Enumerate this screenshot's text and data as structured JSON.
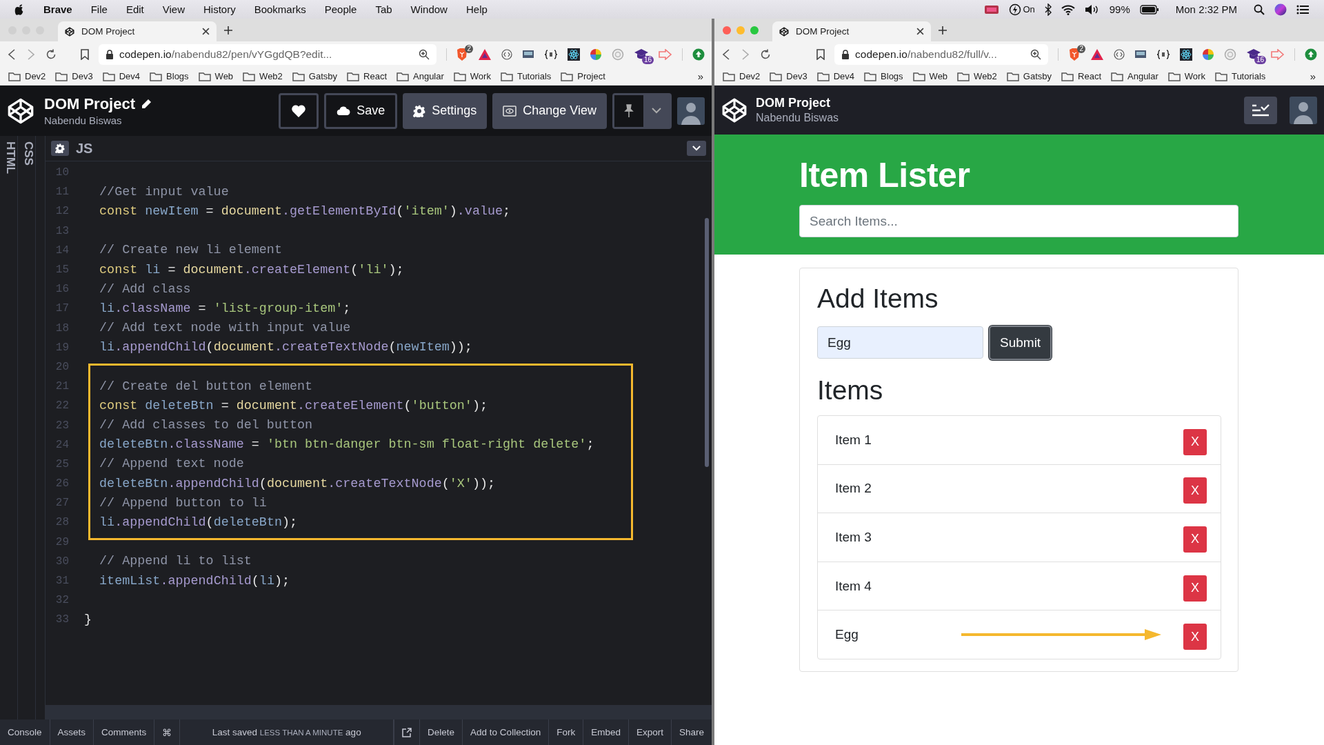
{
  "menu_bar": {
    "app": "Brave",
    "menus": [
      "File",
      "Edit",
      "View",
      "History",
      "Bookmarks",
      "People",
      "Tab",
      "Window",
      "Help"
    ],
    "focus_label": "On",
    "battery": "99%",
    "clock": "Mon 2:32 PM"
  },
  "windows": [
    {
      "active": false,
      "tab_title": "DOM Project",
      "url_host": "codepen.io",
      "url_path": "/nabendu82/pen/vYGgdQB?edit...",
      "shield_badge": "2",
      "extension_badge": "16",
      "bookmarks": [
        "Dev2",
        "Dev3",
        "Dev4",
        "Blogs",
        "Web",
        "Web2",
        "Gatsby",
        "React",
        "Angular",
        "Work",
        "Tutorials",
        "Project"
      ],
      "bookmarks_overflow": "»",
      "page": {
        "kind": "editor",
        "title": "DOM Project",
        "author": "Nabendu Biswas",
        "buttons": [
          {
            "kind": "heart"
          },
          {
            "kind": "save",
            "label": "Save"
          },
          {
            "kind": "settings",
            "label": "Settings"
          },
          {
            "kind": "change-view",
            "label": "Change View"
          }
        ],
        "side_tabs": [
          "HTML",
          "CSS"
        ],
        "panel_label": "JS",
        "code": [
          {
            "highlighted": false,
            "lines": [
              {
                "number": "10"
              },
              {
                "number": "11",
                "tokens": [
                  {
                    "kind": "comment",
                    "text": "  //Get input value"
                  }
                ]
              },
              {
                "number": "12",
                "tokens": [
                  {
                    "kind": "keyword",
                    "text": "  const"
                  },
                  {
                    "kind": "var",
                    "text": " newItem"
                  },
                  {
                    "kind": "punct",
                    "text": " = "
                  },
                  {
                    "kind": "object",
                    "text": "document"
                  },
                  {
                    "kind": "method",
                    "text": ".getElementById"
                  },
                  {
                    "kind": "punct",
                    "text": "("
                  },
                  {
                    "kind": "string",
                    "text": "'item'"
                  },
                  {
                    "kind": "punct",
                    "text": ")"
                  },
                  {
                    "kind": "method",
                    "text": ".value"
                  },
                  {
                    "kind": "punct",
                    "text": ";"
                  }
                ]
              },
              {
                "number": "13"
              },
              {
                "number": "14",
                "tokens": [
                  {
                    "kind": "comment",
                    "text": "  // Create new li element"
                  }
                ]
              },
              {
                "number": "15",
                "tokens": [
                  {
                    "kind": "keyword",
                    "text": "  const"
                  },
                  {
                    "kind": "var",
                    "text": " li"
                  },
                  {
                    "kind": "punct",
                    "text": " = "
                  },
                  {
                    "kind": "object",
                    "text": "document"
                  },
                  {
                    "kind": "method",
                    "text": ".createElement"
                  },
                  {
                    "kind": "punct",
                    "text": "("
                  },
                  {
                    "kind": "string",
                    "text": "'li'"
                  },
                  {
                    "kind": "punct",
                    "text": ");"
                  }
                ]
              },
              {
                "number": "16",
                "tokens": [
                  {
                    "kind": "comment",
                    "text": "  // Add class"
                  }
                ]
              },
              {
                "number": "17",
                "tokens": [
                  {
                    "kind": "var",
                    "text": "  li"
                  },
                  {
                    "kind": "method",
                    "text": ".className"
                  },
                  {
                    "kind": "punct",
                    "text": " = "
                  },
                  {
                    "kind": "string",
                    "text": "'list-group-item'"
                  },
                  {
                    "kind": "punct",
                    "text": ";"
                  }
                ]
              },
              {
                "number": "18",
                "tokens": [
                  {
                    "kind": "comment",
                    "text": "  // Add text node with input value"
                  }
                ]
              },
              {
                "number": "19",
                "tokens": [
                  {
                    "kind": "var",
                    "text": "  li"
                  },
                  {
                    "kind": "method",
                    "text": ".appendChild"
                  },
                  {
                    "kind": "punct",
                    "text": "("
                  },
                  {
                    "kind": "object",
                    "text": "document"
                  },
                  {
                    "kind": "method",
                    "text": ".createTextNode"
                  },
                  {
                    "kind": "punct",
                    "text": "("
                  },
                  {
                    "kind": "var",
                    "text": "newItem"
                  },
                  {
                    "kind": "punct",
                    "text": "));"
                  }
                ]
              },
              {
                "number": "20"
              }
            ]
          },
          {
            "highlighted": true,
            "lines": [
              {
                "number": "21",
                "tokens": [
                  {
                    "kind": "comment",
                    "text": "  // Create del button element"
                  }
                ]
              },
              {
                "number": "22",
                "tokens": [
                  {
                    "kind": "keyword",
                    "text": "  const"
                  },
                  {
                    "kind": "var",
                    "text": " deleteBtn"
                  },
                  {
                    "kind": "punct",
                    "text": " = "
                  },
                  {
                    "kind": "object",
                    "text": "document"
                  },
                  {
                    "kind": "method",
                    "text": ".createElement"
                  },
                  {
                    "kind": "punct",
                    "text": "("
                  },
                  {
                    "kind": "string",
                    "text": "'button'"
                  },
                  {
                    "kind": "punct",
                    "text": ");"
                  }
                ]
              },
              {
                "number": "23",
                "tokens": [
                  {
                    "kind": "comment",
                    "text": "  // Add classes to del button"
                  }
                ]
              },
              {
                "number": "24",
                "tokens": [
                  {
                    "kind": "var",
                    "text": "  deleteBtn"
                  },
                  {
                    "kind": "method",
                    "text": ".className"
                  },
                  {
                    "kind": "punct",
                    "text": " = "
                  },
                  {
                    "kind": "string",
                    "text": "'btn btn-danger btn-sm float-right delete'"
                  },
                  {
                    "kind": "punct",
                    "text": ";"
                  }
                ]
              },
              {
                "number": "25",
                "tokens": [
                  {
                    "kind": "comment",
                    "text": "  // Append text node"
                  }
                ]
              },
              {
                "number": "26",
                "tokens": [
                  {
                    "kind": "var",
                    "text": "  deleteBtn"
                  },
                  {
                    "kind": "method",
                    "text": ".appendChild"
                  },
                  {
                    "kind": "punct",
                    "text": "("
                  },
                  {
                    "kind": "object",
                    "text": "document"
                  },
                  {
                    "kind": "method",
                    "text": ".createTextNode"
                  },
                  {
                    "kind": "punct",
                    "text": "("
                  },
                  {
                    "kind": "string",
                    "text": "'X'"
                  },
                  {
                    "kind": "punct",
                    "text": "));"
                  }
                ]
              },
              {
                "number": "27",
                "tokens": [
                  {
                    "kind": "comment",
                    "text": "  // Append button to li"
                  }
                ]
              },
              {
                "number": "28",
                "tokens": [
                  {
                    "kind": "var",
                    "text": "  li"
                  },
                  {
                    "kind": "method",
                    "text": ".appendChild"
                  },
                  {
                    "kind": "punct",
                    "text": "("
                  },
                  {
                    "kind": "var",
                    "text": "deleteBtn"
                  },
                  {
                    "kind": "punct",
                    "text": ");"
                  }
                ]
              }
            ]
          },
          {
            "highlighted": false,
            "lines": [
              {
                "number": "29"
              },
              {
                "number": "30",
                "tokens": [
                  {
                    "kind": "comment",
                    "text": "  // Append li to list"
                  }
                ]
              },
              {
                "number": "31",
                "tokens": [
                  {
                    "kind": "var",
                    "text": "  itemList"
                  },
                  {
                    "kind": "method",
                    "text": ".appendChild"
                  },
                  {
                    "kind": "punct",
                    "text": "("
                  },
                  {
                    "kind": "var",
                    "text": "li"
                  },
                  {
                    "kind": "punct",
                    "text": ");"
                  }
                ]
              },
              {
                "number": "32"
              },
              {
                "number": "33",
                "tokens": [
                  {
                    "kind": "punct",
                    "text": "}"
                  }
                ]
              }
            ]
          }
        ],
        "footer_left": [
          "Console",
          "Assets",
          "Comments",
          "⌘"
        ],
        "last_saved": {
          "prefix": "Last saved",
          "time": "LESS THAN A MINUTE",
          "suffix": "ago"
        },
        "footer_right": [
          "Delete",
          "Add to Collection",
          "Fork",
          "Embed",
          "Export",
          "Share"
        ]
      }
    },
    {
      "active": true,
      "tab_title": "DOM Project",
      "url_host": "codepen.io",
      "url_path": "/nabendu82/full/v...",
      "shield_badge": "2",
      "extension_badge": "16",
      "bookmarks": [
        "Dev2",
        "Dev3",
        "Dev4",
        "Blogs",
        "Web",
        "Web2",
        "Gatsby",
        "React",
        "Angular",
        "Work",
        "Tutorials"
      ],
      "bookmarks_overflow": "»",
      "page": {
        "kind": "preview",
        "title": "DOM Project",
        "author": "Nabendu Biswas",
        "heading": "Item Lister",
        "search_placeholder": "Search Items...",
        "form_heading": "Add Items",
        "input_value": "Egg",
        "submit": "Submit",
        "list_heading": "Items",
        "items": [
          {
            "label": "Item 1",
            "delete": "X",
            "pointed": false
          },
          {
            "label": "Item 2",
            "delete": "X",
            "pointed": false
          },
          {
            "label": "Item 3",
            "delete": "X",
            "pointed": false
          },
          {
            "label": "Item 4",
            "delete": "X",
            "pointed": false
          },
          {
            "label": "Egg",
            "delete": "X",
            "pointed": true
          }
        ]
      }
    }
  ]
}
